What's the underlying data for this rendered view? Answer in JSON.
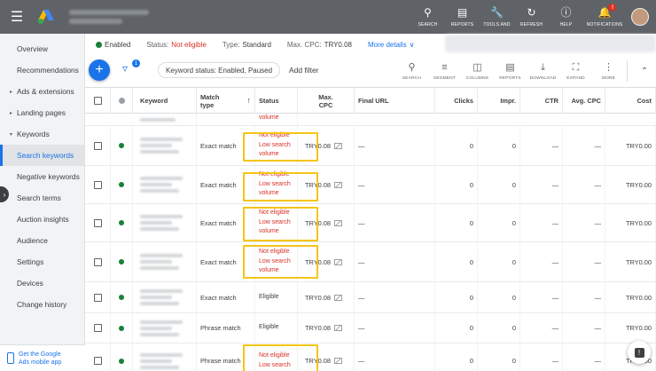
{
  "topbar": {
    "icons": [
      {
        "icon": "search-icon",
        "label": "SEARCH"
      },
      {
        "icon": "reports-icon",
        "label": "REPORTS"
      },
      {
        "icon": "tools-icon",
        "label": "TOOLS AND"
      },
      {
        "icon": "refresh-icon",
        "label": "REFRESH"
      },
      {
        "icon": "help-icon",
        "label": "HELP"
      },
      {
        "icon": "notifications-icon",
        "label": "NOTIFICATIONS",
        "badge": "!"
      }
    ]
  },
  "sidebar": {
    "items": [
      {
        "label": "Overview"
      },
      {
        "label": "Recommendations"
      },
      {
        "label": "Ads & extensions"
      },
      {
        "label": "Landing pages"
      },
      {
        "label": "Keywords"
      },
      {
        "label": "Search keywords"
      },
      {
        "label": "Negative keywords"
      },
      {
        "label": "Search terms"
      },
      {
        "label": "Auction insights"
      },
      {
        "label": "Audience"
      },
      {
        "label": "Settings"
      },
      {
        "label": "Devices"
      },
      {
        "label": "Change history"
      }
    ],
    "mobile_line1": "Get the Google",
    "mobile_line2": "Ads mobile app"
  },
  "statusbar": {
    "enabled": "Enabled",
    "status_label": "Status:",
    "status_value": "Not eligible",
    "type_label": "Type:",
    "type_value": "Standard",
    "maxcpc_label": "Max. CPC:",
    "maxcpc_value": "TRY0.08",
    "more_details": "More details"
  },
  "toolbar": {
    "add": "+",
    "filter_badge": "1",
    "chip": "Keyword status: Enabled, Paused",
    "add_filter": "Add filter",
    "tools": [
      "SEARCH",
      "SEGMENT",
      "COLUMNS",
      "REPORTS",
      "DOWNLOAD",
      "EXPAND",
      "MORE"
    ]
  },
  "table": {
    "headers": {
      "keyword": "Keyword",
      "match_type_1": "Match",
      "match_type_2": "type",
      "status": "Status",
      "maxcpc_1": "Max.",
      "maxcpc_2": "CPC",
      "final_url": "Final URL",
      "clicks": "Clicks",
      "impr": "Impr.",
      "ctr": "CTR",
      "avg_cpc": "Avg. CPC",
      "cost": "Cost"
    },
    "partial_top": "volume",
    "rows": [
      {
        "match": "Exact match",
        "status": [
          "Not eligible",
          "Low search",
          "volume"
        ],
        "cpc": "TRY0.08",
        "url": "—",
        "clicks": "0",
        "impr": "0",
        "ctr": "—",
        "avg": "—",
        "cost": "TRY0.00"
      },
      {
        "match": "Exact match",
        "status": [
          "Not eligible",
          "Low search",
          "volume"
        ],
        "cpc": "TRY0.08",
        "url": "—",
        "clicks": "0",
        "impr": "0",
        "ctr": "—",
        "avg": "—",
        "cost": "TRY0.00"
      },
      {
        "match": "Exact match",
        "status": [
          "Not eligible",
          "Low search",
          "volume"
        ],
        "cpc": "TRY0.08",
        "url": "—",
        "clicks": "0",
        "impr": "0",
        "ctr": "—",
        "avg": "—",
        "cost": "TRY0.00"
      },
      {
        "match": "Exact match",
        "status": [
          "Not eligible",
          "Low search",
          "volume"
        ],
        "cpc": "TRY0.08",
        "url": "—",
        "clicks": "0",
        "impr": "0",
        "ctr": "—",
        "avg": "—",
        "cost": "TRY0.00"
      },
      {
        "match": "Exact match",
        "status": [
          "Eligible"
        ],
        "cpc": "TRY0.08",
        "url": "—",
        "clicks": "0",
        "impr": "0",
        "ctr": "—",
        "avg": "—",
        "cost": "TRY0.00"
      },
      {
        "match": "Phrase match",
        "status": [
          "Eligible"
        ],
        "cpc": "TRY0.08",
        "url": "—",
        "clicks": "0",
        "impr": "0",
        "ctr": "—",
        "avg": "—",
        "cost": "TRY0.00"
      },
      {
        "match": "Phrase match",
        "status": [
          "Not eligible",
          "Low search"
        ],
        "cpc": "TRY0.08",
        "url": "—",
        "clicks": "0",
        "impr": "0",
        "ctr": "—",
        "avg": "—",
        "cost": "TRY0.00"
      }
    ]
  },
  "colors": {
    "accent": "#1a73e8",
    "error": "#d93025",
    "highlight": "#f5c518",
    "enabled": "#188038",
    "topbar": "#5f6368"
  }
}
